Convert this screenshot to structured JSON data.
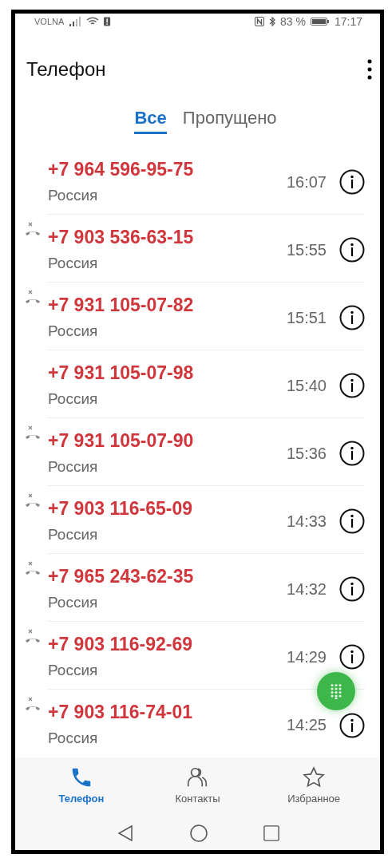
{
  "status_bar": {
    "carrier": "VOLNA",
    "battery": "83 %",
    "time": "17:17"
  },
  "header": {
    "title": "Телефон"
  },
  "tabs": [
    {
      "label": "Все",
      "selected": true
    },
    {
      "label": "Пропущено",
      "selected": false
    }
  ],
  "calls": [
    {
      "number": "+7 964 596-95-75",
      "location": "Россия",
      "time": "16:07",
      "missed": false
    },
    {
      "number": "+7 903 536-63-15",
      "location": "Россия",
      "time": "15:55",
      "missed": true
    },
    {
      "number": "+7 931 105-07-82",
      "location": "Россия",
      "time": "15:51",
      "missed": true
    },
    {
      "number": "+7 931 105-07-98",
      "location": "Россия",
      "time": "15:40",
      "missed": false
    },
    {
      "number": "+7 931 105-07-90",
      "location": "Россия",
      "time": "15:36",
      "missed": true
    },
    {
      "number": "+7 903 116-65-09",
      "location": "Россия",
      "time": "14:33",
      "missed": true
    },
    {
      "number": "+7 965 243-62-35",
      "location": "Россия",
      "time": "14:32",
      "missed": true
    },
    {
      "number": "+7 903 116-92-69",
      "location": "Россия",
      "time": "14:29",
      "missed": true
    },
    {
      "number": "+7 903 116-74-01",
      "location": "Россия",
      "time": "14:25",
      "missed": true
    }
  ],
  "bottom_nav": [
    {
      "kind": "phone",
      "label": "Телефон",
      "selected": true
    },
    {
      "kind": "contacts",
      "label": "Контакты",
      "selected": false
    },
    {
      "kind": "favorites",
      "label": "Избранное",
      "selected": false
    }
  ]
}
